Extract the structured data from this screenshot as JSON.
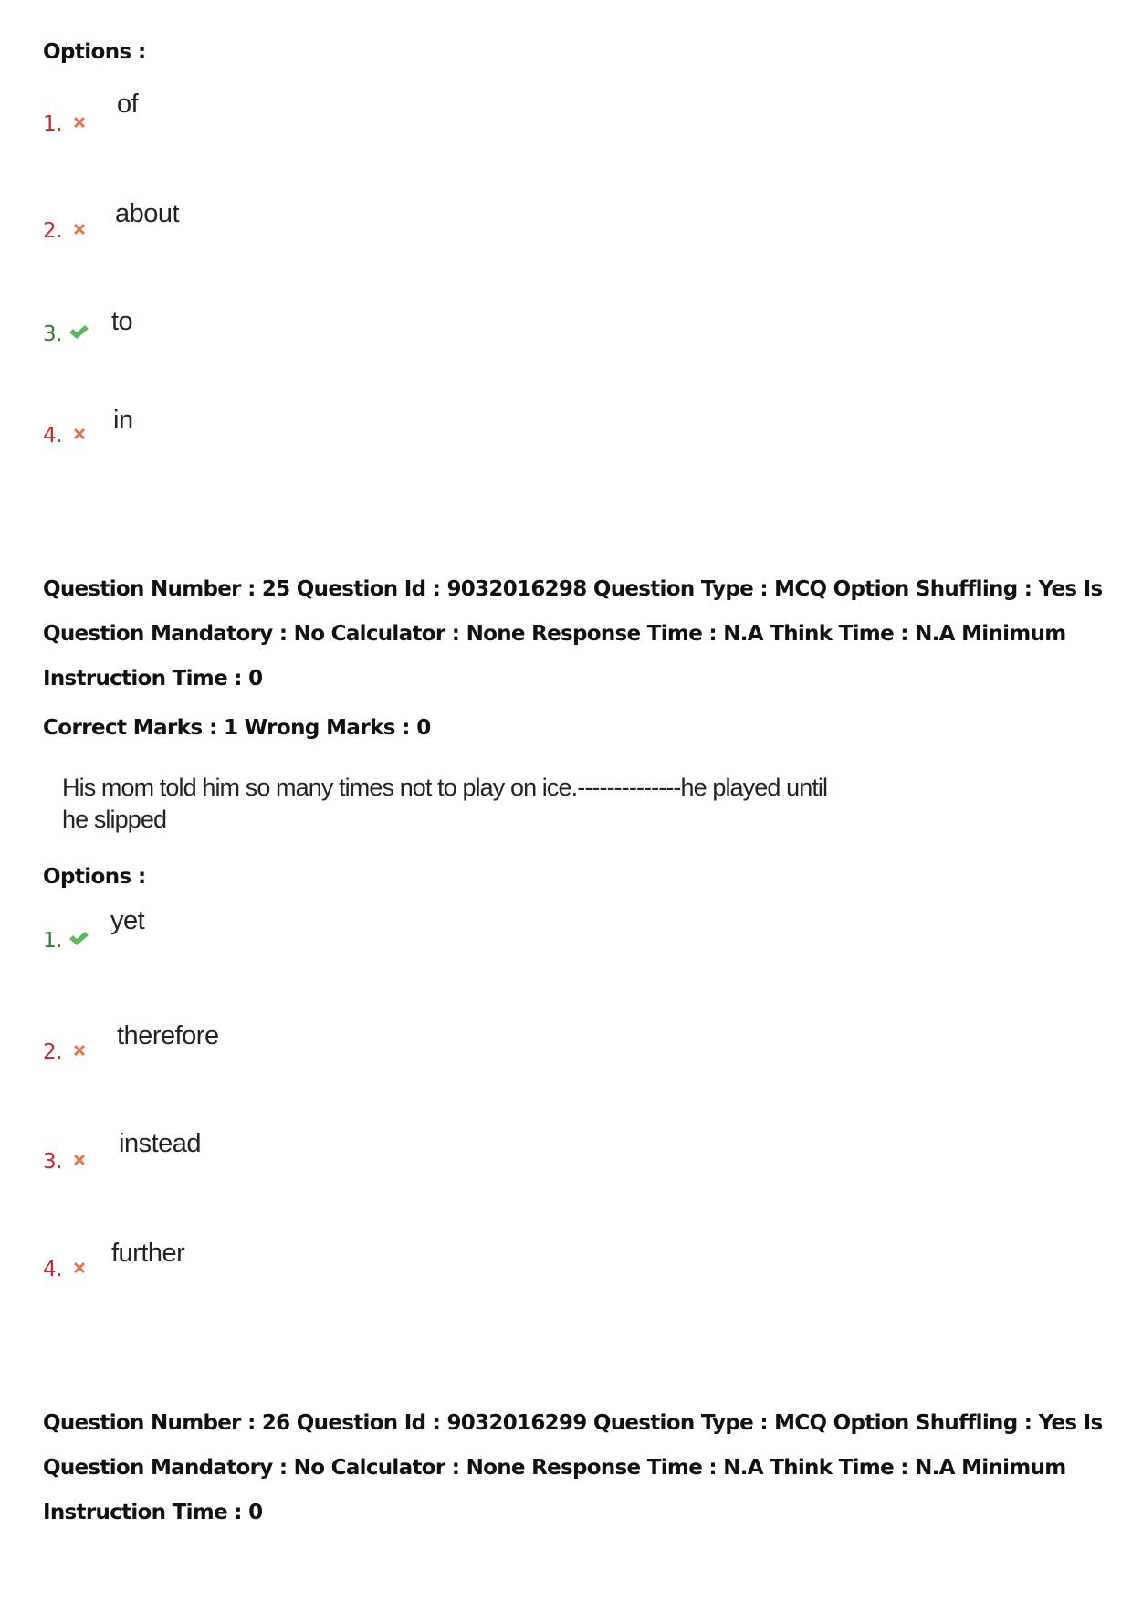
{
  "prev_question": {
    "options_label": "Options :",
    "options": [
      {
        "number": "1.",
        "status": "wrong",
        "icon": "cross-icon",
        "text": "of"
      },
      {
        "number": "2.",
        "status": "wrong",
        "icon": "cross-icon",
        "text": "about"
      },
      {
        "number": "3.",
        "status": "correct",
        "icon": "check-icon",
        "text": "to"
      },
      {
        "number": "4.",
        "status": "wrong",
        "icon": "cross-icon",
        "text": "in"
      }
    ]
  },
  "question_25": {
    "meta": "Question Number : 25 Question Id : 9032016298 Question Type : MCQ Option Shuffling : Yes Is Question Mandatory : No Calculator : None Response Time : N.A Think Time : N.A Minimum Instruction Time : 0",
    "marks": "Correct Marks : 1 Wrong Marks : 0",
    "text_line1": "His mom told him so many times not to play on ice.--------------he played until",
    "text_line2": "he slipped",
    "options_label": "Options :",
    "options": [
      {
        "number": "1.",
        "status": "correct",
        "icon": "check-icon",
        "text": "yet"
      },
      {
        "number": "2.",
        "status": "wrong",
        "icon": "cross-icon",
        "text": "therefore"
      },
      {
        "number": "3.",
        "status": "wrong",
        "icon": "cross-icon",
        "text": "instead"
      },
      {
        "number": "4.",
        "status": "wrong",
        "icon": "cross-icon",
        "text": "further"
      }
    ]
  },
  "question_26": {
    "meta": "Question Number : 26 Question Id : 9032016299 Question Type : MCQ Option Shuffling : Yes Is Question Mandatory : No Calculator : None Response Time : N.A Think Time : N.A Minimum Instruction Time : 0"
  },
  "colors": {
    "wrong": "#c62828",
    "correct": "#2e7d32",
    "cross_icon": "#e8704f",
    "check_icon": "#5cb85c"
  }
}
